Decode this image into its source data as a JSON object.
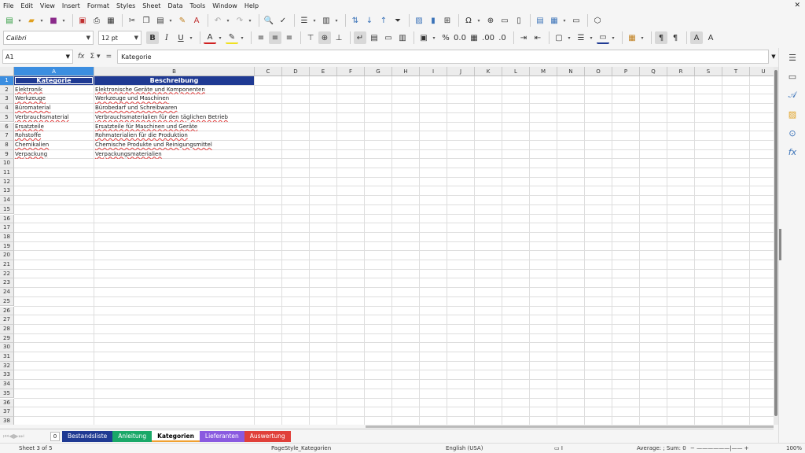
{
  "menu": [
    "File",
    "Edit",
    "View",
    "Insert",
    "Format",
    "Styles",
    "Sheet",
    "Data",
    "Tools",
    "Window",
    "Help"
  ],
  "font": {
    "name": "Calibri",
    "size": "12 pt"
  },
  "formula": {
    "cell_ref": "A1",
    "content": "Kategorie"
  },
  "columns": [
    "A",
    "B",
    "C",
    "D",
    "E",
    "F",
    "G",
    "H",
    "I",
    "J",
    "K",
    "L",
    "M",
    "N",
    "O",
    "P",
    "Q",
    "R",
    "S",
    "T",
    "U"
  ],
  "rows": [
    "1",
    "2",
    "3",
    "4",
    "5",
    "6",
    "7",
    "8",
    "9",
    "10",
    "11",
    "12",
    "13",
    "14",
    "15",
    "16",
    "17",
    "18",
    "19",
    "20",
    "21",
    "22",
    "23",
    "24",
    "25",
    "26",
    "27",
    "28",
    "29",
    "30",
    "31",
    "32",
    "33",
    "34",
    "35",
    "36",
    "37",
    "38"
  ],
  "table": {
    "headers": [
      "Kategorie",
      "Beschreibung"
    ],
    "rows": [
      [
        "Elektronik",
        "Elektronische Geräte und Komponenten"
      ],
      [
        "Werkzeuge",
        "Werkzeuge und Maschinen"
      ],
      [
        "Büromaterial",
        "Bürobedarf und Schreibwaren"
      ],
      [
        "Verbrauchsmaterial",
        "Verbrauchsmaterialien für den täglichen Betrieb"
      ],
      [
        "Ersatzteile",
        "Ersatzteile für Maschinen und Geräte"
      ],
      [
        "Rohstoffe",
        "Rohmaterialien für die Produktion"
      ],
      [
        "Chemikalien",
        "Chemische Produkte und Reinigungsmittel"
      ],
      [
        "Verpackung",
        "Verpackungsmaterialien"
      ]
    ],
    "header_color": "#1f3a93"
  },
  "tabs": [
    {
      "label": "Bestandsliste",
      "color": "#1f3a93",
      "active": false
    },
    {
      "label": "Anleitung",
      "color": "#1aa868",
      "active": false
    },
    {
      "label": "Kategorien",
      "color": "#ffffff",
      "active": true,
      "accent": "#f0a030"
    },
    {
      "label": "Lieferanten",
      "color": "#8a5ae0",
      "active": false
    },
    {
      "label": "Auswertung",
      "color": "#e0403a",
      "active": false
    }
  ],
  "add_tab_label": "0",
  "status": {
    "sheet": "Sheet 3 of 5",
    "page_style": "PageStyle_Kategorien",
    "language": "English (USA)",
    "summary": "Average: ; Sum: 0",
    "zoom": "100%"
  }
}
